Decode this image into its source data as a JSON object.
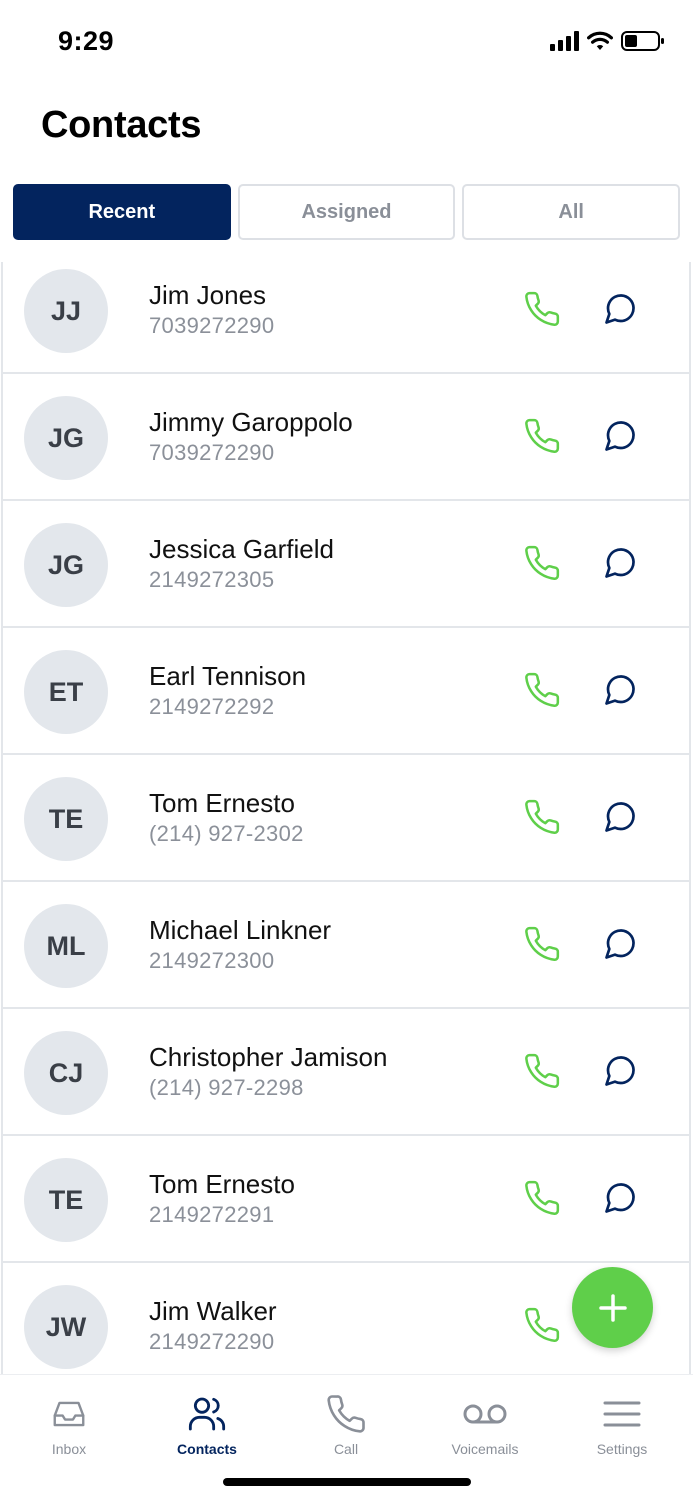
{
  "status_bar": {
    "time": "9:29",
    "icons": [
      "cellular-signal-icon",
      "wifi-icon",
      "battery-icon"
    ]
  },
  "header": {
    "title": "Contacts"
  },
  "tabs": [
    {
      "label": "Recent",
      "active": true
    },
    {
      "label": "Assigned",
      "active": false
    },
    {
      "label": "All",
      "active": false
    }
  ],
  "contacts": [
    {
      "initials": "JJ",
      "name": "Jim Jones",
      "phone": "7039272290"
    },
    {
      "initials": "JG",
      "name": "Jimmy Garoppolo",
      "phone": "7039272290"
    },
    {
      "initials": "JG",
      "name": "Jessica Garfield",
      "phone": "2149272305"
    },
    {
      "initials": "ET",
      "name": "Earl Tennison",
      "phone": "2149272292"
    },
    {
      "initials": "TE",
      "name": "Tom Ernesto",
      "phone": "(214) 927-2302"
    },
    {
      "initials": "ML",
      "name": "Michael Linkner",
      "phone": "2149272300"
    },
    {
      "initials": "CJ",
      "name": "Christopher Jamison",
      "phone": "(214) 927-2298"
    },
    {
      "initials": "TE",
      "name": "Tom Ernesto",
      "phone": "2149272291"
    },
    {
      "initials": "JW",
      "name": "Jim Walker",
      "phone": "2149272290"
    }
  ],
  "row_actions": {
    "call_icon": "phone-icon",
    "message_icon": "chat-bubble-icon"
  },
  "fab": {
    "icon": "plus-icon"
  },
  "bottom_nav": [
    {
      "label": "Inbox",
      "icon": "inbox-icon",
      "active": false
    },
    {
      "label": "Contacts",
      "icon": "contacts-icon",
      "active": true
    },
    {
      "label": "Call",
      "icon": "phone-icon",
      "active": false
    },
    {
      "label": "Voicemails",
      "icon": "voicemail-icon",
      "active": false
    },
    {
      "label": "Settings",
      "icon": "menu-icon",
      "active": false
    }
  ],
  "colors": {
    "primary": "#03245e",
    "call_green": "#5fcf4a",
    "inactive_gray": "#8a8f98",
    "avatar_bg": "#e3e7ec"
  }
}
